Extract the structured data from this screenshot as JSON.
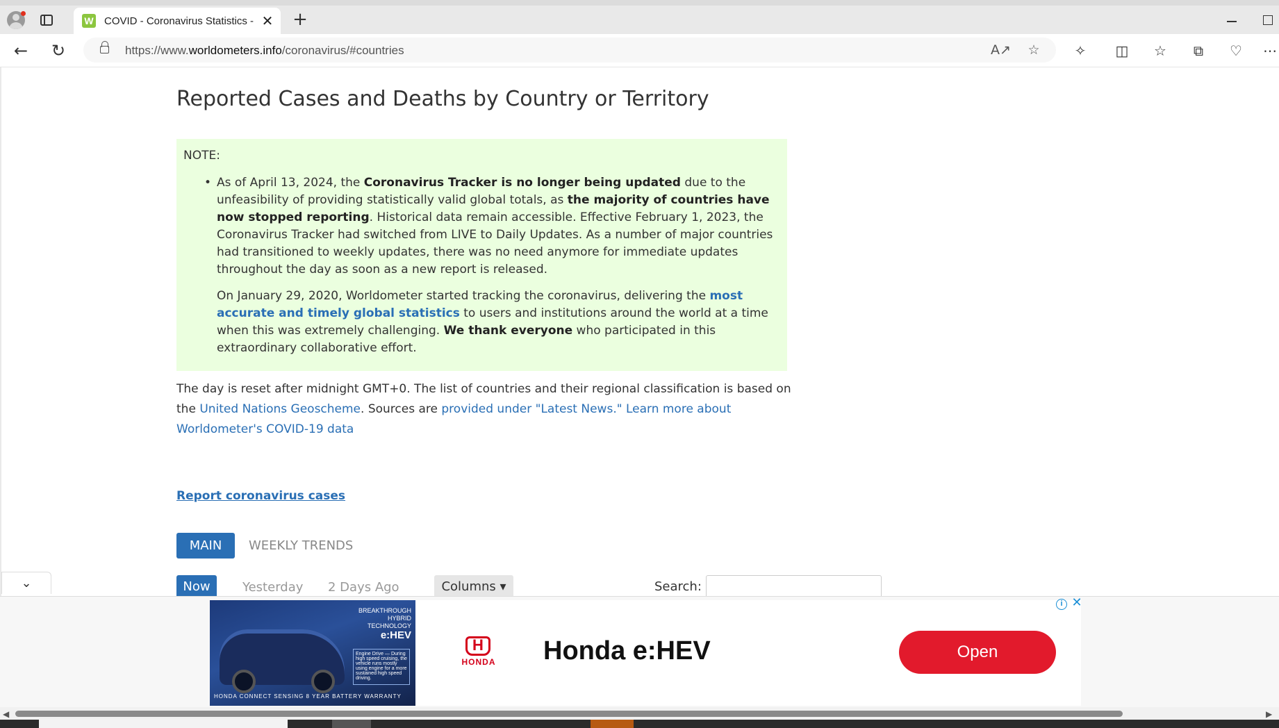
{
  "browser": {
    "tab_title": "COVID - Coronavirus Statistics - Worldometer",
    "favicon_letter": "W",
    "url_scheme": "https://www.",
    "url_host": "worldometers.info",
    "url_path": "/coronavirus/#countries",
    "icons": [
      "back-arrow-icon",
      "refresh-icon",
      "lock-icon",
      "read-aloud-icon",
      "favorite-star-icon",
      "extensions-icon",
      "split-screen-icon",
      "favorites-icon",
      "collections-icon",
      "browser-essentials-icon",
      "more-icon"
    ]
  },
  "page": {
    "title": "Reported Cases and Deaths by Country or Territory",
    "note": {
      "label": "NOTE:",
      "p1_a": "As of April 13, 2024, the ",
      "p1_b": "Coronavirus Tracker is no longer being updated",
      "p1_c": " due to the unfeasibility of providing statistically valid global totals, as ",
      "p1_d": "the majority of countries have now stopped reporting",
      "p1_e": ". Historical data remain accessible. Effective February 1, 2023, the Coronavirus Tracker had switched from LIVE to Daily Updates. As a number of major countries had transitioned to weekly updates, there was no need anymore for immediate updates throughout the day as soon as a new report is released.",
      "p2_a": "On January 29, 2020, Worldometer started tracking the coronavirus, delivering the ",
      "p2_link": "most accurate and timely global statistics",
      "p2_b": " to users and institutions around the world at a time when this was extremely challenging. ",
      "p2_bold": "We thank everyone",
      "p2_c": " who participated in this extraordinary collaborative effort."
    },
    "info": {
      "text_a": "The day is reset after midnight GMT+0. The list of countries and their regional classification is based on the ",
      "link_geoscheme": "United Nations Geoscheme",
      "text_b": ". Sources are ",
      "link_sources": "provided under \"Latest News.\"",
      "text_c": " ",
      "link_learn": "Learn more about Worldometer's COVID-19 data"
    },
    "report_link": "Report coronavirus cases",
    "tabs": {
      "main": "MAIN",
      "weekly": "WEEKLY TRENDS"
    },
    "day_buttons": {
      "now": "Now",
      "yesterday": "Yesterday",
      "two_days": "2 Days Ago"
    },
    "columns_button": "Columns ▾",
    "search_label": "Search:"
  },
  "ad": {
    "img_line1": "BREAKTHROUGH HYBRID TECHNOLOGY",
    "img_line2": "e:HEV",
    "img_box": "Engine Drive — During high speed cruising, the vehicle runs mostly using engine for a more sustained high speed driving.",
    "img_footer": "HONDA   CONNECT   SENSING   8 YEAR BATTERY WARRANTY",
    "brand": "HONDA",
    "headline": "Honda e:HEV",
    "cta": "Open",
    "colors": {
      "cta": "#e21a2c",
      "brand": "#d4001a"
    }
  },
  "colors": {
    "accent": "#2a6fb5",
    "note_bg": "#ebffdf"
  }
}
